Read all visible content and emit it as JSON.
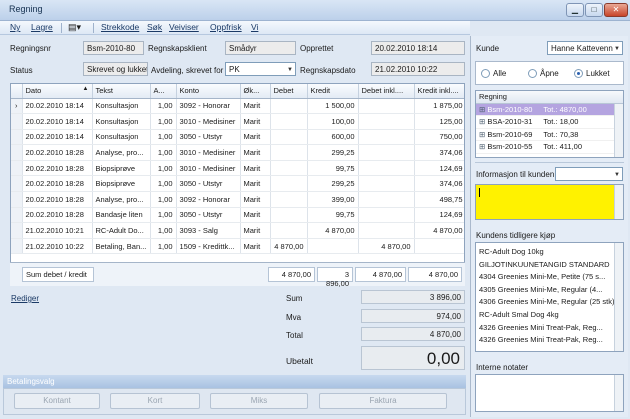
{
  "window": {
    "title": "Regning"
  },
  "menu": {
    "items": [
      "Ny",
      "Lagre",
      "Strekkode",
      "Søk",
      "Veiviser",
      "Oppfrisk",
      "Vi"
    ]
  },
  "header": {
    "regningsnr_label": "Regningsnr",
    "regningsnr": "Bsm-2010-80",
    "klient_label": "Regnskapsklient",
    "klient": "Smådyr",
    "opprettet_label": "Opprettet",
    "opprettet": "20.02.2010 18:14",
    "status_label": "Status",
    "status": "Skrevet og lukket",
    "avdeling_label": "Avdeling, skrevet for",
    "avdeling": "PK",
    "regnskapsdato_label": "Regnskapsdato",
    "regnskapsdato": "21.02.2010 10:22"
  },
  "grid": {
    "columns": [
      "Dato",
      "Tekst",
      "A...",
      "Konto",
      "Øk...",
      "Debet",
      "Kredit",
      "Debet inkl....",
      "Kredit inkl...."
    ],
    "rows": [
      [
        "20.02.2010 18:14",
        "Konsultasjon",
        "1,00",
        "3092 - Honorar",
        "Marit",
        "",
        "1 500,00",
        "",
        "1 875,00"
      ],
      [
        "20.02.2010 18:14",
        "Konsultasjon",
        "1,00",
        "3010 - Medisiner",
        "Marit",
        "",
        "100,00",
        "",
        "125,00"
      ],
      [
        "20.02.2010 18:14",
        "Konsultasjon",
        "1,00",
        "3050 - Utstyr",
        "Marit",
        "",
        "600,00",
        "",
        "750,00"
      ],
      [
        "20.02.2010 18:28",
        "Analyse, pro...",
        "1,00",
        "3010 - Medisiner",
        "Marit",
        "",
        "299,25",
        "",
        "374,06"
      ],
      [
        "20.02.2010 18:28",
        "Biopsiprøve",
        "1,00",
        "3010 - Medisiner",
        "Marit",
        "",
        "99,75",
        "",
        "124,69"
      ],
      [
        "20.02.2010 18:28",
        "Biopsiprøve",
        "1,00",
        "3050 - Utstyr",
        "Marit",
        "",
        "299,25",
        "",
        "374,06"
      ],
      [
        "20.02.2010 18:28",
        "Analyse, pro...",
        "1,00",
        "3092 - Honorar",
        "Marit",
        "",
        "399,00",
        "",
        "498,75"
      ],
      [
        "20.02.2010 18:28",
        "Bandasje liten",
        "1,00",
        "3050 - Utstyr",
        "Marit",
        "",
        "99,75",
        "",
        "124,69"
      ],
      [
        "21.02.2010 10:21",
        "RC-Adult Do...",
        "1,00",
        "3093 - Salg",
        "Marit",
        "",
        "4 870,00",
        "",
        "4 870,00"
      ],
      [
        "21.02.2010 10:22",
        "Betaling, Ban...",
        "1,00",
        "1509 - Kredittk...",
        "Marit",
        "4 870,00",
        "",
        "4 870,00",
        ""
      ]
    ],
    "footer_label": "Sum debet / kredit",
    "footer_values": [
      "4 870,00",
      "3 896,00",
      "4 870,00",
      "4 870,00"
    ]
  },
  "summary": {
    "rediger": "Rediger",
    "sum_label": "Sum",
    "sum": "3 896,00",
    "mva_label": "Mva",
    "mva": "974,00",
    "total_label": "Total",
    "total": "4 870,00",
    "ubetalt_label": "Ubetalt",
    "ubetalt": "0,00"
  },
  "payment": {
    "header": "Betalingsvalg",
    "buttons": [
      "Kontant",
      "Kort",
      "Miks",
      "Faktura"
    ]
  },
  "right": {
    "kunde_label": "Kunde",
    "kunde": "Hanne Kattevenn",
    "radios": [
      "Alle",
      "Åpne",
      "Lukket"
    ],
    "regning_header": "Regning",
    "regninger": [
      {
        "nr": "Bsm-2010-80",
        "tot": "Tot.: 4870,00"
      },
      {
        "nr": "BSA-2010-31",
        "tot": "Tot.: 18,00"
      },
      {
        "nr": "Bsm-2010-69",
        "tot": "Tot.: 70,38"
      },
      {
        "nr": "Bsm-2010-55",
        "tot": "Tot.: 411,00"
      }
    ],
    "info_label": "Informasjon til kunden",
    "tidligere_label": "Kundens tidligere kjøp",
    "tidligere": [
      "RC-Adult Dog 10kg",
      "GILJOTINKUUNETANGID STANDARD",
      "4304 Greenies Mini-Me, Petite (75 s...",
      "4305 Greenies Mini-Me, Regular (4...",
      "4306 Greenies Mini-Me, Regular (25 stk)",
      "RC-Adult Smal Dog 4kg",
      "4326 Greenies Mini Treat-Pak, Reg...",
      "4326 Greenies Mini Treat-Pak, Reg..."
    ],
    "interne_label": "Interne notater"
  }
}
